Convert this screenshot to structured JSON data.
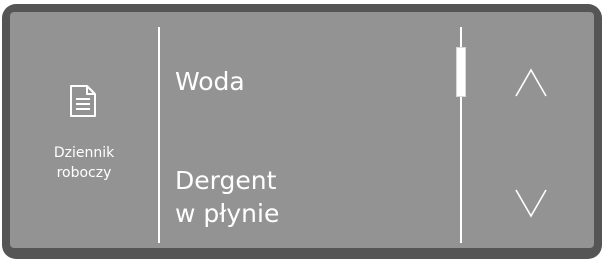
{
  "sidebar": {
    "icon": "document-icon",
    "label_line1": "Dziennik",
    "label_line2": "roboczy"
  },
  "list": {
    "items": [
      {
        "line1": "Woda",
        "line2": ""
      },
      {
        "line1": "Dergent",
        "line2": "w płynie"
      }
    ]
  },
  "scroll": {
    "up_icon": "chevron-up-icon",
    "down_icon": "chevron-down-icon",
    "position": 0.0
  },
  "colors": {
    "frame": "#555555",
    "screen": "#939393",
    "foreground": "#ffffff"
  }
}
